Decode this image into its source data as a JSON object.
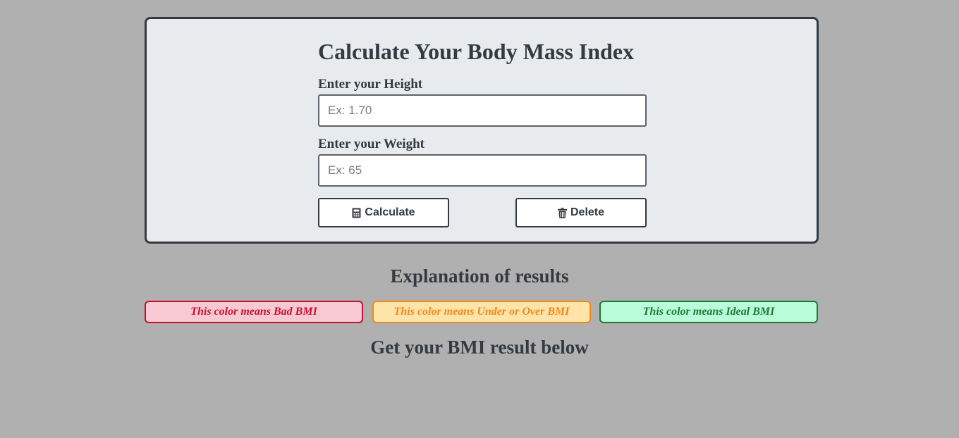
{
  "form": {
    "title": "Calculate Your Body Mass Index",
    "height_label": "Enter your Height",
    "height_placeholder": "Ex: 1.70",
    "height_value": "",
    "weight_label": "Enter your Weight",
    "weight_placeholder": "Ex: 65",
    "weight_value": "",
    "calculate_label": "Calculate",
    "calculate_icon": "calculator-icon",
    "delete_label": "Delete",
    "delete_icon": "trash-icon"
  },
  "explanation": {
    "title": "Explanation of results",
    "legend": [
      {
        "text": "This color means Bad BMI",
        "color": "#c8102e",
        "background": "#f8c9d2"
      },
      {
        "text": "This color means Under or Over BMI",
        "color": "#f0891a",
        "background": "#ffe4aa"
      },
      {
        "text": "This color means Ideal BMI",
        "color": "#1e7b34",
        "background": "#b8fcd9"
      }
    ]
  },
  "result": {
    "title": "Get your BMI result below"
  },
  "colors": {
    "page_background": "#b0b0b0",
    "card_background": "#e7ebee",
    "text_dark": "#343a40"
  }
}
